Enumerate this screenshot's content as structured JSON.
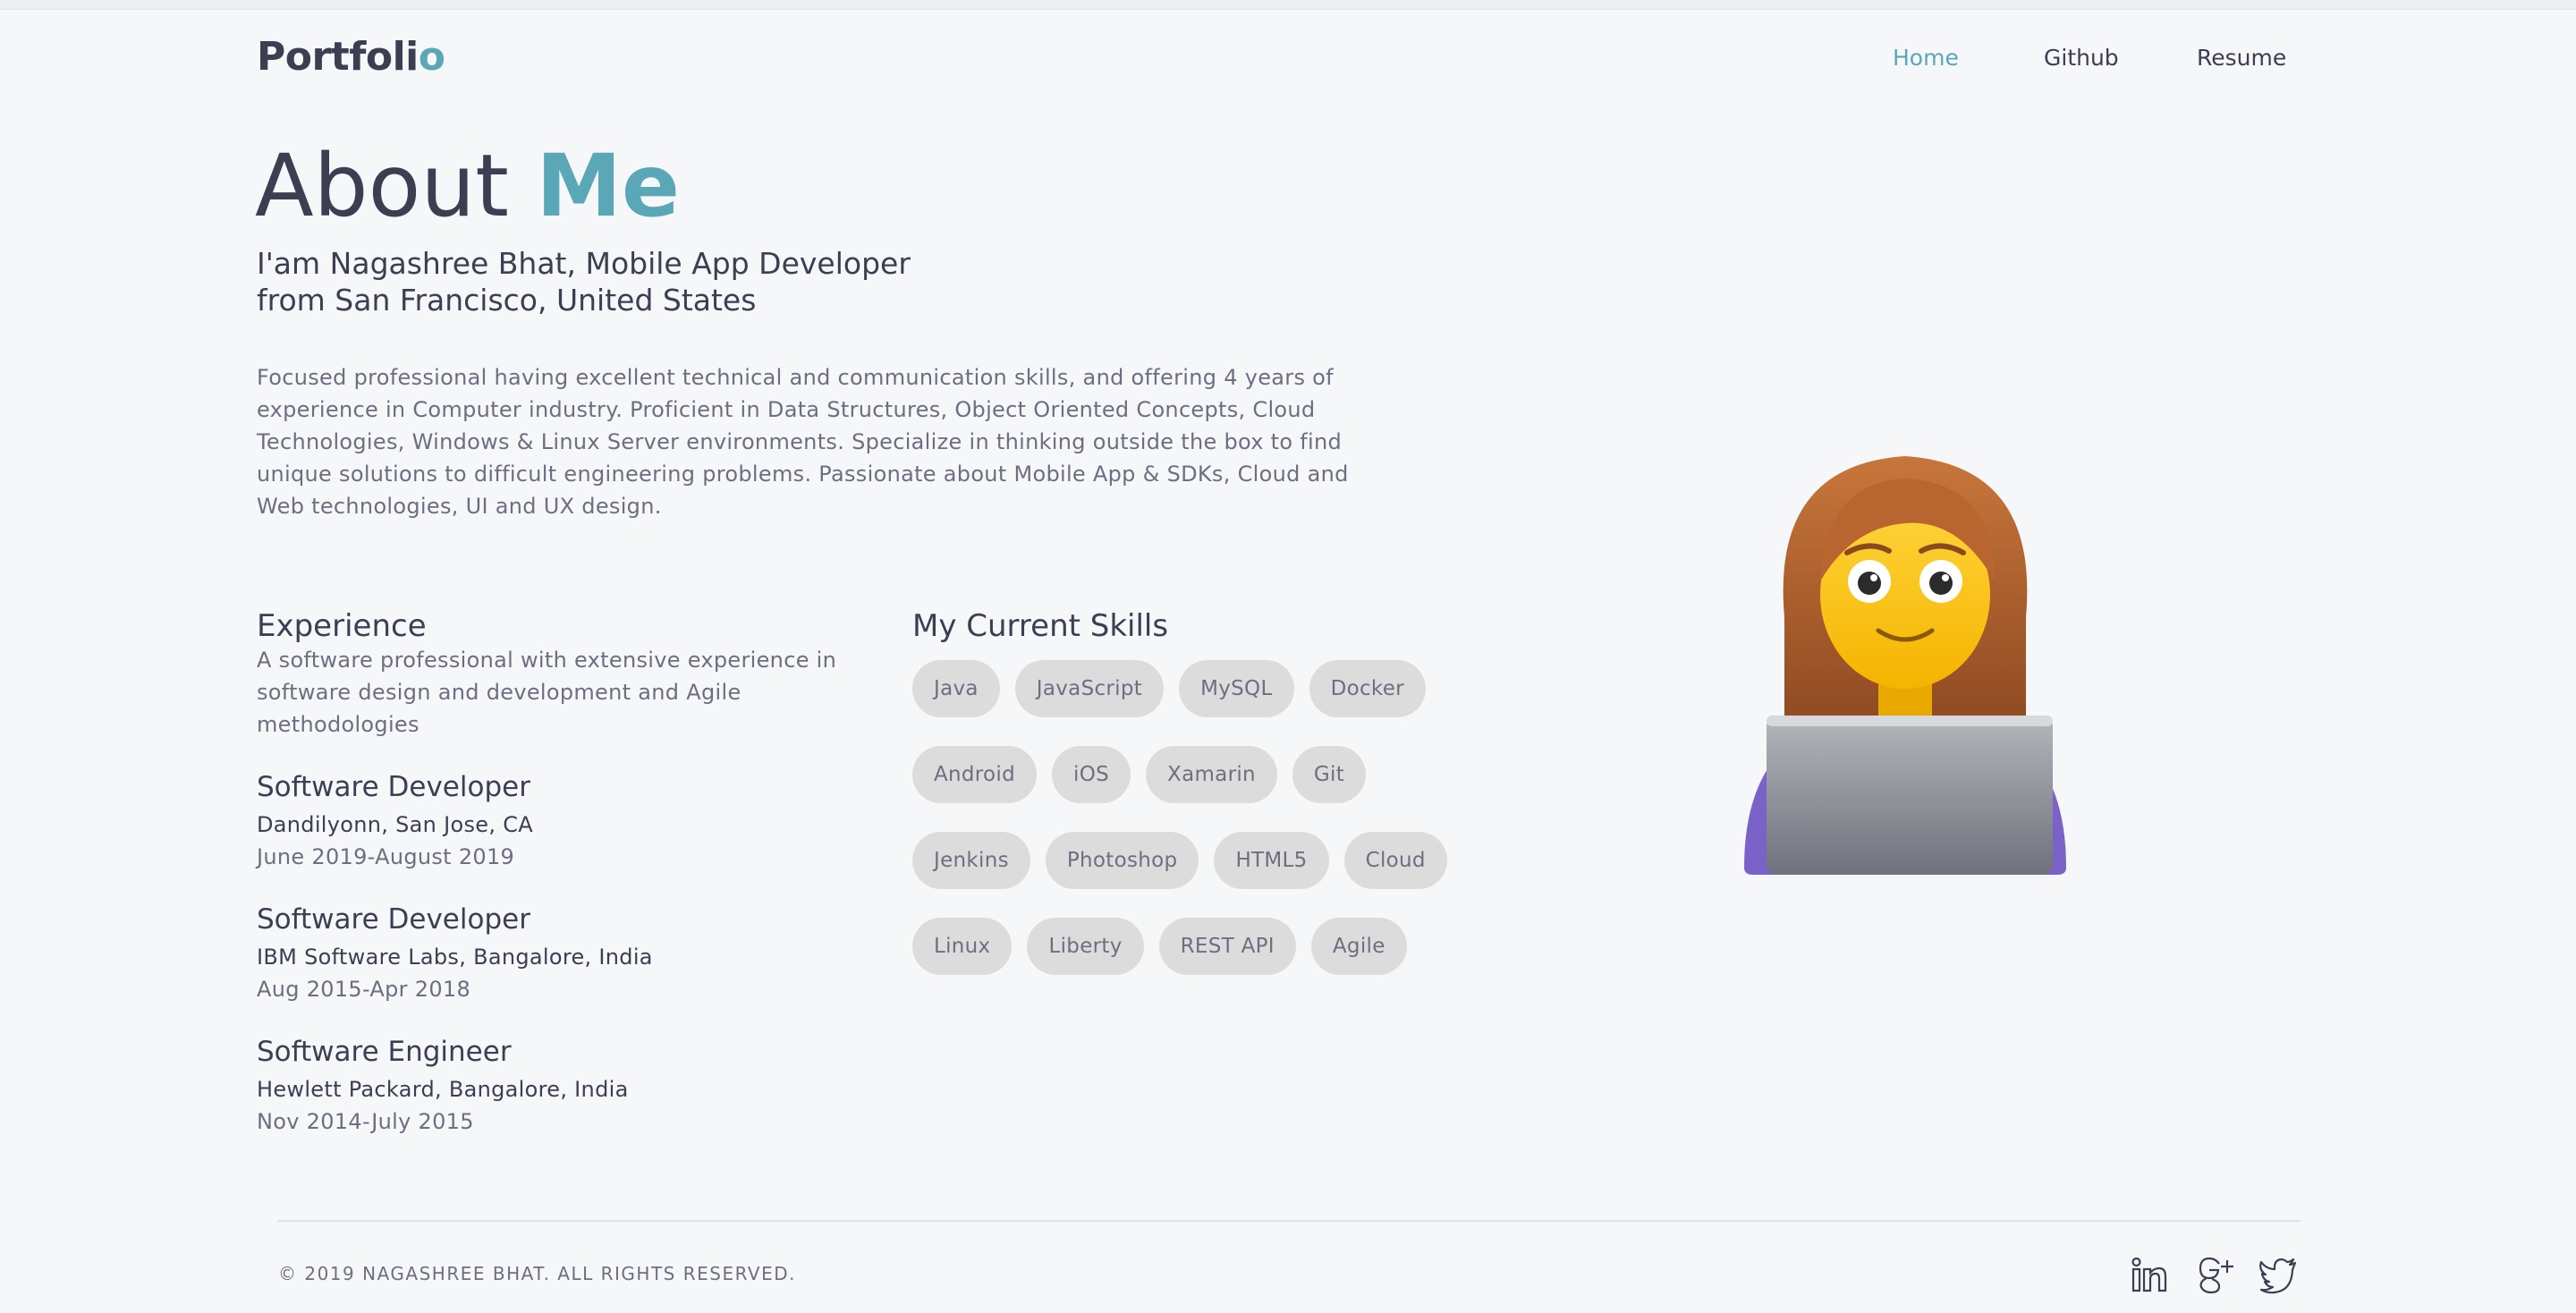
{
  "brand": {
    "main": "Portfoli",
    "accent": "o"
  },
  "nav": {
    "home": "Home",
    "github": "Github",
    "resume": "Resume"
  },
  "hero": {
    "title_prefix": "About ",
    "title_accent": "Me",
    "tagline_line1": "I'am Nagashree Bhat, Mobile App Developer",
    "tagline_line2": "from San Francisco, United States",
    "bio": "Focused professional having excellent technical and communication skills, and offering 4 years of experience in Computer industry. Proficient in Data Structures, Object Oriented Concepts, Cloud Technologies, Windows & Linux Server environments. Specialize in thinking outside the box to find unique solutions to difficult engineering problems. Passionate about Mobile App & SDKs, Cloud and Web technologies, UI and UX design."
  },
  "experience": {
    "title": "Experience",
    "description": "A software professional with extensive experience in software design and development and Agile methodologies",
    "jobs": [
      {
        "role": "Software Developer",
        "company": "Dandilyonn, San Jose, CA",
        "dates": "June 2019-August 2019"
      },
      {
        "role": "Software Developer",
        "company": "IBM Software Labs, Bangalore, India",
        "dates": "Aug 2015-Apr 2018"
      },
      {
        "role": "Software Engineer",
        "company": "Hewlett Packard, Bangalore, India",
        "dates": "Nov 2014-July 2015"
      }
    ]
  },
  "skills": {
    "title": "My Current Skills",
    "rows": [
      [
        "Java",
        "JavaScript",
        "MySQL",
        "Docker"
      ],
      [
        "Android",
        "iOS",
        "Xamarin",
        "Git"
      ],
      [
        "Jenkins",
        "Photoshop",
        "HTML5",
        "Cloud"
      ],
      [
        "Linux",
        "Liberty",
        "REST API",
        "Agile"
      ]
    ]
  },
  "footer": {
    "copyright": "© 2019 NAGASHREE BHAT. ALL RIGHTS RESERVED.",
    "social_icons": [
      "linkedin-icon",
      "google-plus-icon",
      "twitter-icon"
    ]
  },
  "colors": {
    "accent": "#5aa7b8",
    "text": "#3d3e52",
    "muted": "#6d6e80",
    "chip": "#dcdcdc",
    "background": "#f6f7f9"
  }
}
